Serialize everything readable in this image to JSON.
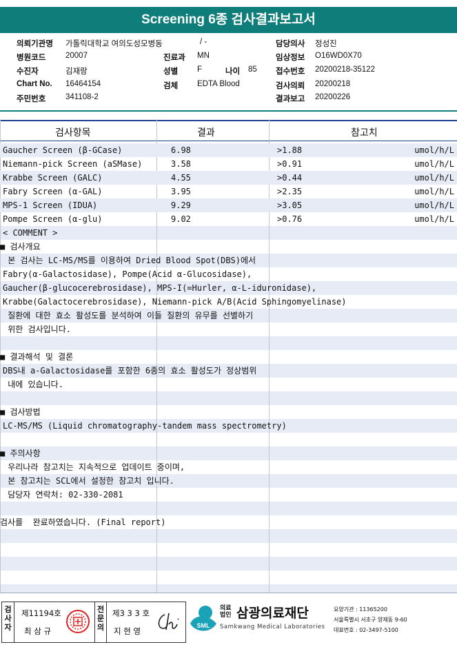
{
  "report_title": "Screening 6종 검사결과보고서",
  "info": {
    "institution_label": "의뢰기관명",
    "institution_value": "가톨릭대학교 여의도성모병동",
    "ward_label": "병동",
    "ward_value": "/ -",
    "doctor_label": "담당의사",
    "doctor_value": "정성진",
    "hospital_code_label": "병원코드",
    "hospital_code_value": "20007",
    "dept_label": "진료과",
    "dept_value": "MN",
    "clinical_label": "임상정보",
    "clinical_value": "O16WD0X70",
    "patient_label": "수진자",
    "patient_value": "김재랑",
    "sex_label": "성별",
    "sex_value": "F",
    "age_label": "나이",
    "age_value": "85",
    "receipt_label": "접수번호",
    "receipt_value": "20200218-35122",
    "chart_label": "Chart No.",
    "chart_value": "16464154",
    "specimen_label": "검체",
    "specimen_value": "EDTA Blood",
    "request_label": "검사의뢰",
    "request_value": "20200218",
    "resident_label": "주민번호",
    "resident_value": "341108-2",
    "report_label": "결과보고",
    "report_value": "20200226"
  },
  "table": {
    "headers": {
      "item": "검사항목",
      "result": "결과",
      "reference": "참고치"
    },
    "rows": [
      {
        "item": "Gaucher Screen (β-GCase)",
        "result": "6.98",
        "reference": ">1.88",
        "unit": "umol/h/L"
      },
      {
        "item": "Niemann-pick Screen (aSMase)",
        "result": "3.58",
        "reference": ">0.91",
        "unit": "umol/h/L"
      },
      {
        "item": "Krabbe Screen (GALC)",
        "result": "4.55",
        "reference": ">0.44",
        "unit": "umol/h/L"
      },
      {
        "item": "Fabry Screen (α-GAL)",
        "result": "3.95",
        "reference": ">2.35",
        "unit": "umol/h/L"
      },
      {
        "item": "MPS-1 Screen (IDUA)",
        "result": "9.29",
        "reference": ">3.05",
        "unit": "umol/h/L"
      },
      {
        "item": "Pompe Screen (α-glu)",
        "result": "9.02",
        "reference": ">0.76",
        "unit": "umol/h/L"
      }
    ]
  },
  "comment_lines": [
    "< COMMENT >",
    "■ 검사개요",
    " 본 검사는 LC-MS/MS를 이용하여 Dried Blood Spot(DBS)에서",
    "Fabry(α-Galactosidase), Pompe(Acid α-Glucosidase),",
    "Gaucher(β-glucocerebrosidase), MPS-I(=Hurler, α-L-iduronidase),",
    "Krabbe(Galactocerebrosidase), Niemann-pick A/B(Acid Sphingomyelinase)",
    " 질환에 대한 효소 활성도를 분석하여 이들 질환의 유무를 선별하기",
    " 위한 검사입니다.",
    "",
    "■ 결과해석 및 결론",
    "DBS내 a-Galactosidase를 포함한 6종의 효소 활성도가 정상범위",
    " 내에 있습니다.",
    "",
    "■ 검사방법",
    "LC-MS/MS (Liquid chromatography-tandem mass spectrometry)",
    "",
    "■ 주의사항",
    " 우리나라 참고치는 지속적으로 업데이트 중이며,",
    " 본 참고치는 SCL에서 설정한 참고치 입니다.",
    " 담당자 연락처: 02-330-2081",
    "",
    "검사를  완료하였습니다. (Final report)"
  ],
  "footer": {
    "tester_label": "검사자",
    "tester_no": "제11194호",
    "tester_name": "최 삼 규",
    "specialist_label": "전문의",
    "specialist_no": "제3 3 3 호",
    "specialist_name": "지 현 영",
    "org_prefix": "의료법인",
    "org_name": "삼광의료재단",
    "org_english": "Samkwang Medical Laboratories",
    "logo_text": "SML",
    "org_code": "요양기관 : 11365200",
    "org_address": "서울특별시 서초구 양재동 9-60",
    "org_phone": "대표번호 : 02-3497-5100"
  },
  "colors": {
    "title_bg": "#0f7d7a",
    "stripe": "#e7ebf5",
    "logo": "#1aa3b8"
  }
}
